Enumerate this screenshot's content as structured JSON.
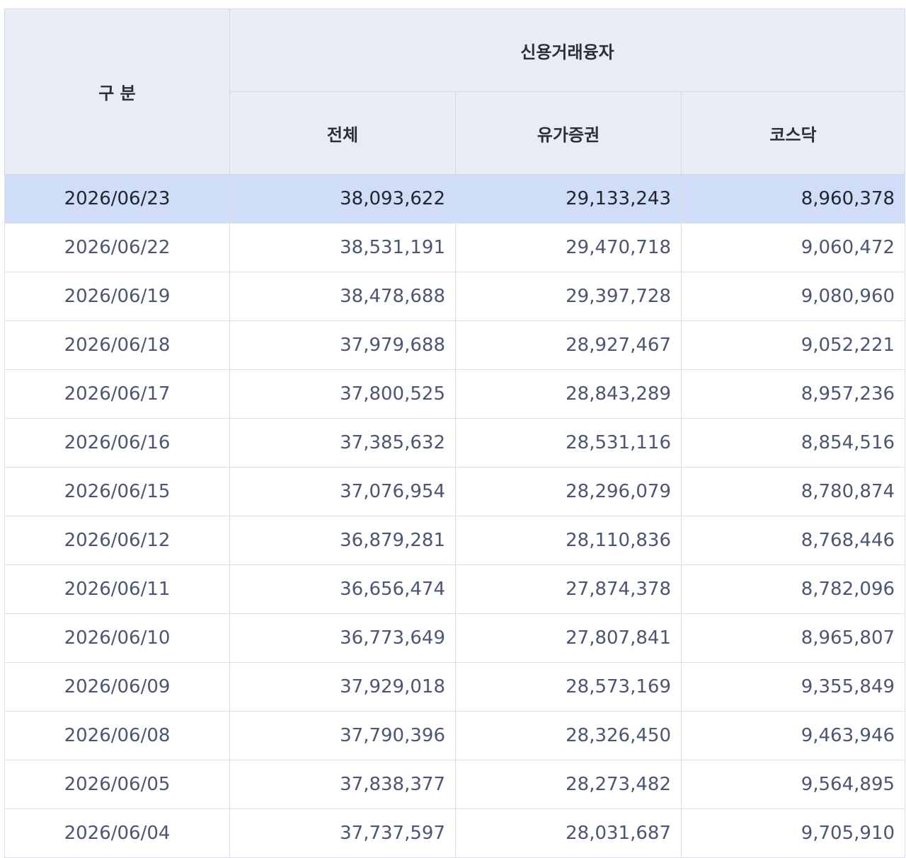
{
  "table": {
    "header": {
      "category_label": "구 분",
      "group_label": "신용거래융자",
      "sub_labels": [
        "전체",
        "유가증권",
        "코스닥"
      ]
    },
    "rows": [
      {
        "date": "2026/06/23",
        "total": "38,093,622",
        "kospi": "29,133,243",
        "kosdaq": "8,960,378",
        "selected": true
      },
      {
        "date": "2026/06/22",
        "total": "38,531,191",
        "kospi": "29,470,718",
        "kosdaq": "9,060,472"
      },
      {
        "date": "2026/06/19",
        "total": "38,478,688",
        "kospi": "29,397,728",
        "kosdaq": "9,080,960"
      },
      {
        "date": "2026/06/18",
        "total": "37,979,688",
        "kospi": "28,927,467",
        "kosdaq": "9,052,221"
      },
      {
        "date": "2026/06/17",
        "total": "37,800,525",
        "kospi": "28,843,289",
        "kosdaq": "8,957,236"
      },
      {
        "date": "2026/06/16",
        "total": "37,385,632",
        "kospi": "28,531,116",
        "kosdaq": "8,854,516"
      },
      {
        "date": "2026/06/15",
        "total": "37,076,954",
        "kospi": "28,296,079",
        "kosdaq": "8,780,874"
      },
      {
        "date": "2026/06/12",
        "total": "36,879,281",
        "kospi": "28,110,836",
        "kosdaq": "8,768,446"
      },
      {
        "date": "2026/06/11",
        "total": "36,656,474",
        "kospi": "27,874,378",
        "kosdaq": "8,782,096"
      },
      {
        "date": "2026/06/10",
        "total": "36,773,649",
        "kospi": "27,807,841",
        "kosdaq": "8,965,807"
      },
      {
        "date": "2026/06/09",
        "total": "37,929,018",
        "kospi": "28,573,169",
        "kosdaq": "9,355,849"
      },
      {
        "date": "2026/06/08",
        "total": "37,790,396",
        "kospi": "28,326,450",
        "kosdaq": "9,463,946"
      },
      {
        "date": "2026/06/05",
        "total": "37,838,377",
        "kospi": "28,273,482",
        "kosdaq": "9,564,895"
      },
      {
        "date": "2026/06/04",
        "total": "37,737,597",
        "kospi": "28,031,687",
        "kosdaq": "9,705,910"
      }
    ]
  }
}
